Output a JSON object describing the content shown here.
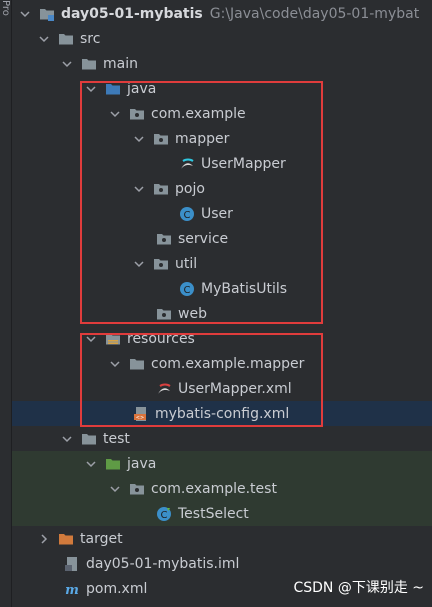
{
  "project": {
    "name": "day05-01-mybatis",
    "path": "G:\\Java\\code\\day05-01-mybat"
  },
  "tree": {
    "src": "src",
    "main": "main",
    "java": "java",
    "com_example": "com.example",
    "mapper": "mapper",
    "user_mapper": "UserMapper",
    "pojo": "pojo",
    "user": "User",
    "service": "service",
    "util": "util",
    "mybatis_utils": "MyBatisUtils",
    "web": "web",
    "resources": "resources",
    "com_example_mapper": "com.example.mapper",
    "user_mapper_xml": "UserMapper.xml",
    "mybatis_config": "mybatis-config.xml",
    "test": "test",
    "test_java": "java",
    "com_example_test": "com.example.test",
    "test_select": "TestSelect",
    "target": "target",
    "iml": "day05-01-mybatis.iml",
    "pom": "pom.xml"
  },
  "sidebar": {
    "tab_label": "Pro"
  },
  "watermark": "CSDN @下课别走 ~",
  "colors": {
    "highlight": "#e03c3c",
    "selected_row": "#1f3148",
    "test_row": "#2f3a31"
  }
}
